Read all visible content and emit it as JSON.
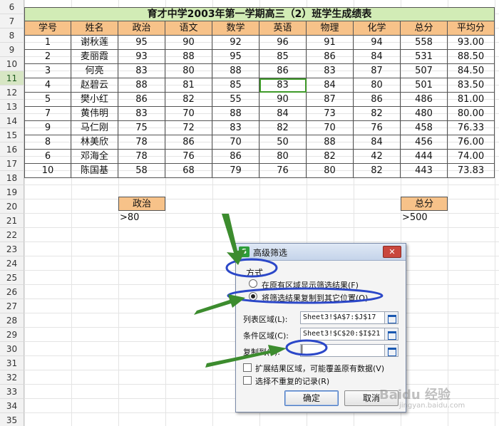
{
  "sheet": {
    "row_numbers": [
      "6",
      "7",
      "8",
      "9",
      "10",
      "11",
      "12",
      "13",
      "14",
      "15",
      "16",
      "17",
      "18",
      "19",
      "20",
      "21",
      "22",
      "23",
      "24",
      "25",
      "26",
      "27",
      "28",
      "29",
      "30",
      "31",
      "32",
      "33",
      "34",
      "35"
    ],
    "active_row": "11",
    "title": "育才中学2003年第一学期高三（2）班学生成绩表",
    "headers": [
      "学号",
      "姓名",
      "政治",
      "语文",
      "数学",
      "英语",
      "物理",
      "化学",
      "总分",
      "平均分"
    ],
    "rows": [
      [
        "1",
        "谢秋莲",
        "95",
        "90",
        "92",
        "96",
        "91",
        "94",
        "558",
        "93.00"
      ],
      [
        "2",
        "麦丽霞",
        "93",
        "88",
        "95",
        "85",
        "86",
        "84",
        "531",
        "88.50"
      ],
      [
        "3",
        "何亮",
        "83",
        "80",
        "88",
        "86",
        "83",
        "87",
        "507",
        "84.50"
      ],
      [
        "4",
        "赵碧云",
        "88",
        "81",
        "85",
        "83",
        "84",
        "80",
        "501",
        "83.50"
      ],
      [
        "5",
        "樊小红",
        "86",
        "82",
        "55",
        "90",
        "87",
        "86",
        "486",
        "81.00"
      ],
      [
        "7",
        "黄伟明",
        "83",
        "70",
        "88",
        "84",
        "73",
        "82",
        "480",
        "80.00"
      ],
      [
        "9",
        "马仁刚",
        "75",
        "72",
        "83",
        "82",
        "70",
        "76",
        "458",
        "76.33"
      ],
      [
        "8",
        "林美欣",
        "78",
        "86",
        "70",
        "50",
        "88",
        "84",
        "456",
        "76.00"
      ],
      [
        "6",
        "邓海全",
        "78",
        "76",
        "86",
        "80",
        "82",
        "42",
        "444",
        "74.00"
      ],
      [
        "10",
        "陈国基",
        "58",
        "68",
        "79",
        "76",
        "80",
        "82",
        "443",
        "73.83"
      ]
    ],
    "criteria": {
      "zhengzhi_header": "政治",
      "zhengzhi_value": ">80",
      "zongfen_header": "总分",
      "zongfen_value": ">500"
    },
    "colors": {
      "title_bg": "#d2ecb6",
      "header_bg": "#f7c289",
      "selection": "#3f9a2a"
    }
  },
  "dialog": {
    "title": "高级筛选",
    "close_label": "✕",
    "mode_label": "方式",
    "option_in_place": "在原有区域显示筛选结果(F)",
    "option_copy": "将筛选结果复制到其它位置(O)",
    "selected_option": "copy",
    "list_range_label": "列表区域(L):",
    "list_range_value": "Sheet3!$A$7:$J$17",
    "criteria_range_label": "条件区域(C):",
    "criteria_range_value": "Sheet3!$C$20:$I$21",
    "copy_to_label": "复制到(T):",
    "copy_to_value": "",
    "expand_label": "扩展结果区域，可能覆盖原有数据(V)",
    "unique_label": "选择不重复的记录(R)",
    "ok_label": "确定",
    "cancel_label": "取消"
  },
  "watermark": {
    "text": "Baidu 经验",
    "sub": "jingyan.baidu.com"
  }
}
